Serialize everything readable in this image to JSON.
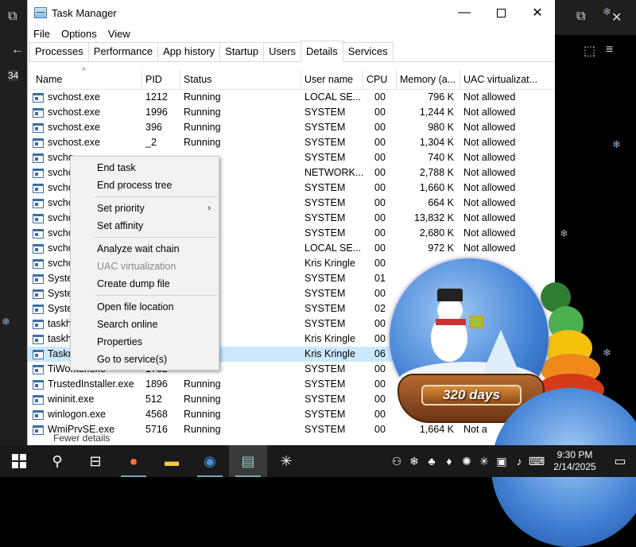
{
  "window": {
    "title": "Task Manager"
  },
  "caption_buttons": {
    "minimize": "—",
    "maximize": "",
    "close": "✕"
  },
  "menu": [
    "File",
    "Options",
    "View"
  ],
  "tabs": [
    "Processes",
    "Performance",
    "App history",
    "Startup",
    "Users",
    "Details",
    "Services"
  ],
  "active_tab": "Details",
  "columns": [
    "Name",
    "PID",
    "Status",
    "User name",
    "CPU",
    "Memory (a...",
    "UAC virtualizat..."
  ],
  "rows": [
    {
      "name": "svchost.exe",
      "pid": "1212",
      "status": "Running",
      "user": "LOCAL SE...",
      "cpu": "00",
      "mem": "796 K",
      "uac": "Not allowed"
    },
    {
      "name": "svchost.exe",
      "pid": "1996",
      "status": "Running",
      "user": "SYSTEM",
      "cpu": "00",
      "mem": "1,244 K",
      "uac": "Not allowed"
    },
    {
      "name": "svchost.exe",
      "pid": "396",
      "status": "Running",
      "user": "SYSTEM",
      "cpu": "00",
      "mem": "980 K",
      "uac": "Not allowed"
    },
    {
      "name": "svchost.exe",
      "pid": "_2",
      "status": "Running",
      "user": "SYSTEM",
      "cpu": "00",
      "mem": "1,304 K",
      "uac": "Not allowed"
    },
    {
      "name": "svcho",
      "pid": "",
      "status": "",
      "user": "SYSTEM",
      "cpu": "00",
      "mem": "740 K",
      "uac": "Not allowed"
    },
    {
      "name": "svcho",
      "pid": "",
      "status": "",
      "user": "NETWORK...",
      "cpu": "00",
      "mem": "2,788 K",
      "uac": "Not allowed"
    },
    {
      "name": "svcho",
      "pid": "",
      "status": "",
      "user": "SYSTEM",
      "cpu": "00",
      "mem": "1,660 K",
      "uac": "Not allowed"
    },
    {
      "name": "svcho",
      "pid": "",
      "status": "",
      "user": "SYSTEM",
      "cpu": "00",
      "mem": "664 K",
      "uac": "Not allowed"
    },
    {
      "name": "svcho",
      "pid": "",
      "status": "",
      "user": "SYSTEM",
      "cpu": "00",
      "mem": "13,832 K",
      "uac": "Not allowed"
    },
    {
      "name": "svcho",
      "pid": "",
      "status": "",
      "user": "SYSTEM",
      "cpu": "00",
      "mem": "2,680 K",
      "uac": "Not allowed"
    },
    {
      "name": "svcho",
      "pid": "",
      "status": "",
      "user": "LOCAL SE...",
      "cpu": "00",
      "mem": "972 K",
      "uac": "Not allowed"
    },
    {
      "name": "svcho",
      "pid": "",
      "status": "",
      "user": "Kris Kringle",
      "cpu": "00",
      "mem": "",
      "uac": ""
    },
    {
      "name": "Syster",
      "pid": "",
      "status": "",
      "user": "SYSTEM",
      "cpu": "01",
      "mem": "",
      "uac": ""
    },
    {
      "name": "Syster",
      "pid": "",
      "status": "",
      "user": "SYSTEM",
      "cpu": "00",
      "mem": "",
      "uac": ""
    },
    {
      "name": "Syster",
      "pid": "",
      "status": "",
      "user": "SYSTEM",
      "cpu": "02",
      "mem": "",
      "uac": ""
    },
    {
      "name": "taskho",
      "pid": "",
      "status": "",
      "user": "SYSTEM",
      "cpu": "00",
      "mem": "",
      "uac": ""
    },
    {
      "name": "taskho",
      "pid": "",
      "status": "",
      "user": "Kris Kringle",
      "cpu": "00",
      "mem": "",
      "uac": ""
    },
    {
      "name": "Taskm",
      "pid": "",
      "status": "",
      "user": "Kris Kringle",
      "cpu": "06",
      "mem": "",
      "uac": ""
    },
    {
      "name": "TiWorker.exe",
      "pid": "1732",
      "status": "",
      "user": "SYSTEM",
      "cpu": "00",
      "mem": "",
      "uac": ""
    },
    {
      "name": "TrustedInstaller.exe",
      "pid": "1896",
      "status": "Running",
      "user": "SYSTEM",
      "cpu": "00",
      "mem": "",
      "uac": ""
    },
    {
      "name": "wininit.exe",
      "pid": "512",
      "status": "Running",
      "user": "SYSTEM",
      "cpu": "00",
      "mem": "",
      "uac": ""
    },
    {
      "name": "winlogon.exe",
      "pid": "4568",
      "status": "Running",
      "user": "SYSTEM",
      "cpu": "00",
      "mem": "",
      "uac": ""
    },
    {
      "name": "WmiPrvSE.exe",
      "pid": "5716",
      "status": "Running",
      "user": "SYSTEM",
      "cpu": "00",
      "mem": "1,664 K",
      "uac": "Not a"
    }
  ],
  "selected_row": 17,
  "context_menu": [
    {
      "label": "End task"
    },
    {
      "label": "End process tree"
    },
    {
      "sep": true
    },
    {
      "label": "Set priority",
      "submenu": true
    },
    {
      "label": "Set affinity"
    },
    {
      "sep": true
    },
    {
      "label": "Analyze wait chain"
    },
    {
      "label": "UAC virtualization",
      "disabled": true
    },
    {
      "label": "Create dump file"
    },
    {
      "sep": true
    },
    {
      "label": "Open file location"
    },
    {
      "label": "Search online"
    },
    {
      "label": "Properties"
    },
    {
      "label": "Go to service(s)"
    }
  ],
  "fewer_details": "Fewer details",
  "globe": {
    "days_label": "320 days"
  },
  "desktop": {
    "corner_label": "34"
  },
  "taskbar": {
    "items": [
      "windows-start",
      "search",
      "task-view",
      "firefox",
      "file-explorer",
      "snow-globe-app",
      "task-manager",
      "snowflake-app",
      "snowflake-app-2"
    ],
    "time": "9:30 PM",
    "date": "2/14/2025"
  }
}
